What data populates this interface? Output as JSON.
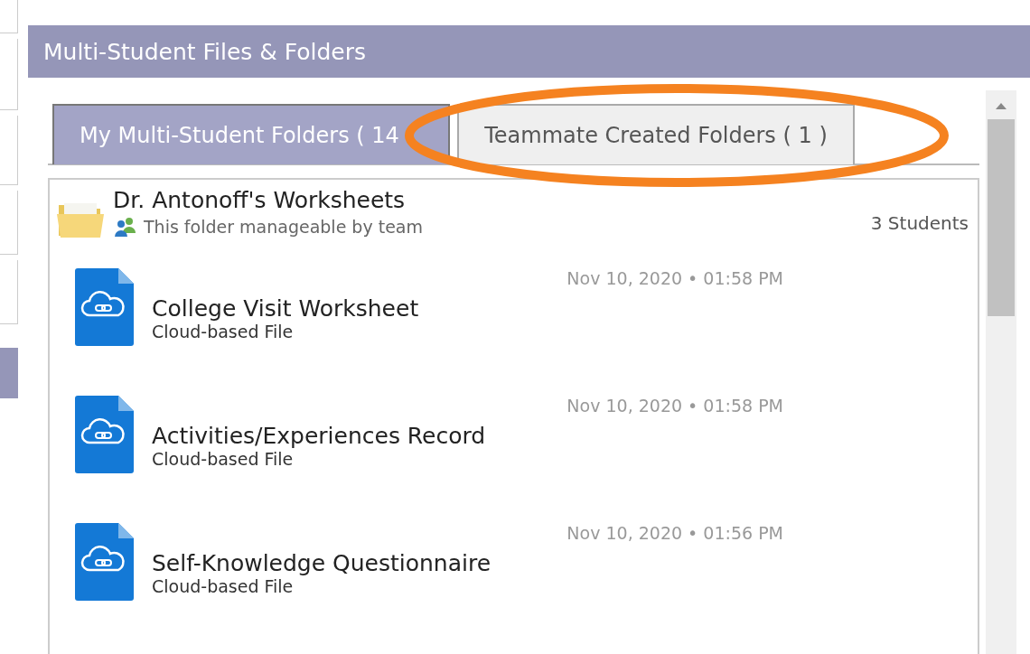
{
  "panel": {
    "title": "Multi-Student Files & Folders"
  },
  "tabs": [
    {
      "label": "My Multi-Student Folders ( 14",
      "selected": true
    },
    {
      "label": "Teammate Created Folders ( 1 )",
      "selected": false
    }
  ],
  "folder": {
    "name": "Dr. Antonoff's Worksheets",
    "note": "This folder manageable by team",
    "count": "3 Students"
  },
  "files": [
    {
      "name": "College Visit Worksheet",
      "type": "Cloud-based File",
      "date": "Nov 10, 2020 • 01:58 PM"
    },
    {
      "name": "Activities/Experiences Record",
      "type": "Cloud-based File",
      "date": "Nov 10, 2020 • 01:58 PM"
    },
    {
      "name": "Self-Knowledge Questionnaire",
      "type": "Cloud-based File",
      "date": "Nov 10, 2020 • 01:56 PM"
    }
  ]
}
